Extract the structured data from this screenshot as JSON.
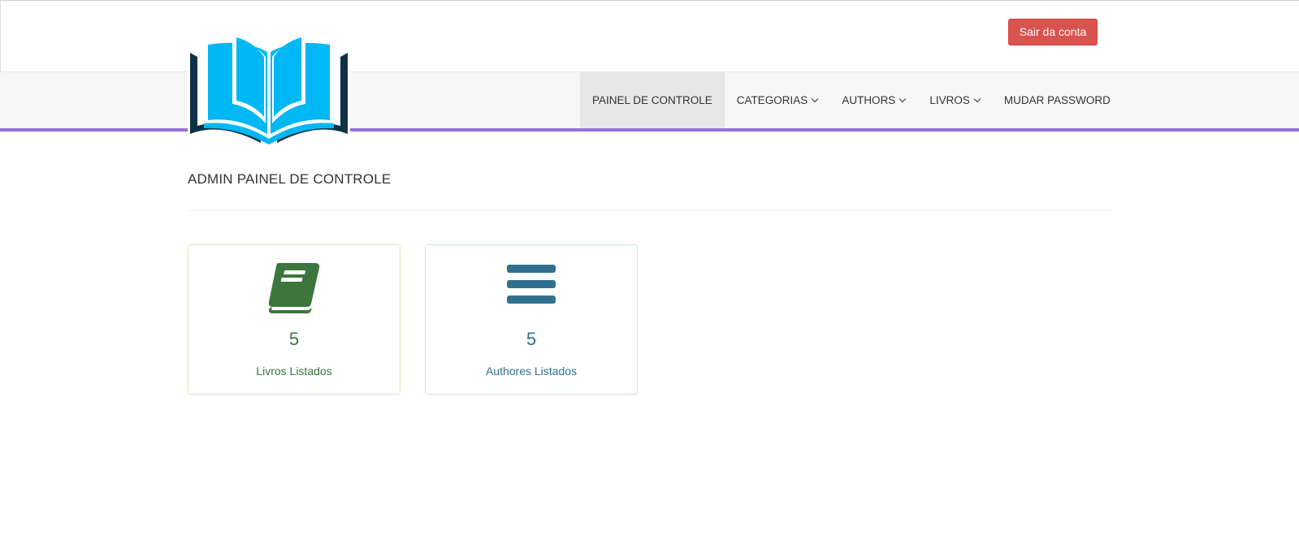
{
  "header": {
    "logout_label": "Sair da conta"
  },
  "nav": {
    "items": [
      {
        "label": "PAINEL DE CONTROLE"
      },
      {
        "label": "CATEGORIAS"
      },
      {
        "label": "AUTHORS"
      },
      {
        "label": "LIVROS"
      },
      {
        "label": "MUDAR PASSWORD"
      }
    ]
  },
  "main": {
    "title": "ADMIN PAINEL DE CONTROLE",
    "cards": [
      {
        "icon": "book-icon",
        "count": "5",
        "label": "Livros Listados",
        "color": "#3c763d"
      },
      {
        "icon": "bars-icon",
        "count": "5",
        "label": "Authores Listados",
        "color": "#31708f"
      }
    ]
  },
  "colors": {
    "accent": "#9370db",
    "danger": "#d9534f",
    "logo_light": "#00b8f5",
    "logo_dark": "#0d3147"
  }
}
